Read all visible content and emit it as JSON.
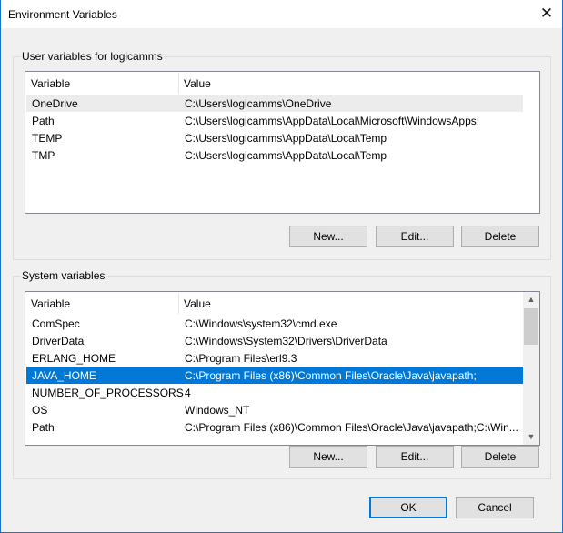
{
  "window": {
    "title": "Environment Variables",
    "close_glyph": "✕"
  },
  "user": {
    "legend": "User variables for logicamms",
    "col_variable": "Variable",
    "col_value": "Value",
    "rows": [
      {
        "name": "OneDrive",
        "value": "C:\\Users\\logicamms\\OneDrive"
      },
      {
        "name": "Path",
        "value": "C:\\Users\\logicamms\\AppData\\Local\\Microsoft\\WindowsApps;"
      },
      {
        "name": "TEMP",
        "value": "C:\\Users\\logicamms\\AppData\\Local\\Temp"
      },
      {
        "name": "TMP",
        "value": "C:\\Users\\logicamms\\AppData\\Local\\Temp"
      }
    ],
    "new": "New...",
    "edit": "Edit...",
    "delete": "Delete"
  },
  "system": {
    "legend": "System variables",
    "col_variable": "Variable",
    "col_value": "Value",
    "rows": [
      {
        "name": "ComSpec",
        "value": "C:\\Windows\\system32\\cmd.exe"
      },
      {
        "name": "DriverData",
        "value": "C:\\Windows\\System32\\Drivers\\DriverData"
      },
      {
        "name": "ERLANG_HOME",
        "value": "C:\\Program Files\\erl9.3"
      },
      {
        "name": "JAVA_HOME",
        "value": "C:\\Program Files (x86)\\Common Files\\Oracle\\Java\\javapath;"
      },
      {
        "name": "NUMBER_OF_PROCESSORS",
        "value": "4"
      },
      {
        "name": "OS",
        "value": "Windows_NT"
      },
      {
        "name": "Path",
        "value": "C:\\Program Files (x86)\\Common Files\\Oracle\\Java\\javapath;C:\\Win..."
      }
    ],
    "new": "New...",
    "edit": "Edit...",
    "delete": "Delete",
    "scroll_up": "▲",
    "scroll_down": "▼"
  },
  "footer": {
    "ok": "OK",
    "cancel": "Cancel"
  },
  "colors": {
    "selection": "#0078d7"
  }
}
